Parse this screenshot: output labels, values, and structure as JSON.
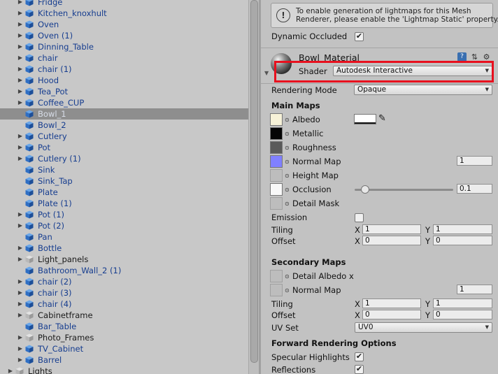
{
  "hierarchy": [
    {
      "name": "Fridge",
      "expand": true,
      "icon": "cube",
      "sel": false
    },
    {
      "name": "Kitchen_knoxhult",
      "expand": true,
      "icon": "cube",
      "sel": false
    },
    {
      "name": "Oven",
      "expand": true,
      "icon": "cube",
      "sel": false
    },
    {
      "name": "Oven (1)",
      "expand": true,
      "icon": "cube",
      "sel": false
    },
    {
      "name": "Dinning_Table",
      "expand": true,
      "icon": "cube",
      "sel": false
    },
    {
      "name": "chair",
      "expand": true,
      "icon": "cube",
      "sel": false
    },
    {
      "name": "chair (1)",
      "expand": true,
      "icon": "cube",
      "sel": false
    },
    {
      "name": "Hood",
      "expand": true,
      "icon": "cube",
      "sel": false
    },
    {
      "name": "Tea_Pot",
      "expand": true,
      "icon": "cube",
      "sel": false
    },
    {
      "name": "Coffee_CUP",
      "expand": true,
      "icon": "cube",
      "sel": false
    },
    {
      "name": "Bowl_1",
      "expand": false,
      "icon": "cube",
      "sel": true
    },
    {
      "name": "Bowl_2",
      "expand": false,
      "icon": "cube",
      "sel": false
    },
    {
      "name": "Cutlery",
      "expand": true,
      "icon": "cube",
      "sel": false
    },
    {
      "name": "Pot",
      "expand": true,
      "icon": "cube",
      "sel": false
    },
    {
      "name": "Cutlery (1)",
      "expand": true,
      "icon": "cube",
      "sel": false
    },
    {
      "name": "Sink",
      "expand": false,
      "icon": "cube",
      "sel": false
    },
    {
      "name": "Sink_Tap",
      "expand": false,
      "icon": "cube",
      "sel": false
    },
    {
      "name": "Plate",
      "expand": false,
      "icon": "cube",
      "sel": false
    },
    {
      "name": "Plate (1)",
      "expand": false,
      "icon": "cube",
      "sel": false
    },
    {
      "name": "Pot (1)",
      "expand": true,
      "icon": "cube",
      "sel": false
    },
    {
      "name": "Pot (2)",
      "expand": true,
      "icon": "cube",
      "sel": false
    },
    {
      "name": "Pan",
      "expand": false,
      "icon": "cube",
      "sel": false
    },
    {
      "name": "Bottle",
      "expand": true,
      "icon": "cube",
      "sel": false
    },
    {
      "name": "Light_panels",
      "expand": true,
      "icon": "gray",
      "sel": false
    },
    {
      "name": "Bathroom_Wall_2 (1)",
      "expand": false,
      "icon": "cube",
      "sel": false
    },
    {
      "name": "chair (2)",
      "expand": true,
      "icon": "cube",
      "sel": false
    },
    {
      "name": "chair (3)",
      "expand": true,
      "icon": "cube",
      "sel": false
    },
    {
      "name": "chair (4)",
      "expand": true,
      "icon": "cube",
      "sel": false
    },
    {
      "name": "Cabinetframe",
      "expand": true,
      "icon": "gray",
      "sel": false
    },
    {
      "name": "Bar_Table",
      "expand": false,
      "icon": "cube",
      "sel": false
    },
    {
      "name": "Photo_Frames",
      "expand": true,
      "icon": "gray",
      "sel": false
    },
    {
      "name": "TV_Cabinet",
      "expand": true,
      "icon": "cube",
      "sel": false
    },
    {
      "name": "Barrel",
      "expand": true,
      "icon": "cube",
      "sel": false
    },
    {
      "name": "Lights",
      "expand": true,
      "icon": "gray",
      "sel": false,
      "root": true
    }
  ],
  "inspector": {
    "help_line1": "To enable generation of lightmaps for this Mesh",
    "help_line2": "Renderer, please enable the 'Lightmap Static' property.",
    "dynamic_occluded_label": "Dynamic Occluded",
    "dynamic_occluded_checked": true,
    "material_name": "Bowl_Material",
    "shader_label": "Shader",
    "shader_value": "Autodesk Interactive",
    "rendering_mode_label": "Rendering Mode",
    "rendering_mode_value": "Opaque",
    "main_maps_title": "Main Maps",
    "albedo_label": "Albedo",
    "metallic_label": "Metallic",
    "roughness_label": "Roughness",
    "normal_map_label": "Normal Map",
    "normal_map_value": "1",
    "height_map_label": "Height Map",
    "occlusion_label": "Occlusion",
    "occlusion_value": "0.1",
    "occlusion_slider_fraction": 0.1,
    "detail_mask_label": "Detail Mask",
    "emission_label": "Emission",
    "emission_checked": false,
    "tiling_label": "Tiling",
    "offset_label": "Offset",
    "x_label": "X",
    "y_label": "Y",
    "main_tiling_x": "1",
    "main_tiling_y": "1",
    "main_offset_x": "0",
    "main_offset_y": "0",
    "secondary_maps_title": "Secondary Maps",
    "detail_albedo_label": "Detail Albedo x",
    "sec_normal_map_label": "Normal Map",
    "sec_normal_map_value": "1",
    "sec_tiling_x": "1",
    "sec_tiling_y": "1",
    "sec_offset_x": "0",
    "sec_offset_y": "0",
    "uv_set_label": "UV Set",
    "uv_set_value": "UV0",
    "forward_title": "Forward Rendering Options",
    "specular_label": "Specular Highlights",
    "specular_checked": true,
    "reflections_label": "Reflections",
    "reflections_checked": true,
    "colors": {
      "albedo": "#f7f2d8",
      "metallic": "#050505",
      "roughness": "#5a5a5a",
      "normal": "#8080ff",
      "occlusion": "#f8f8f8",
      "highlight": "#e8101e"
    }
  }
}
